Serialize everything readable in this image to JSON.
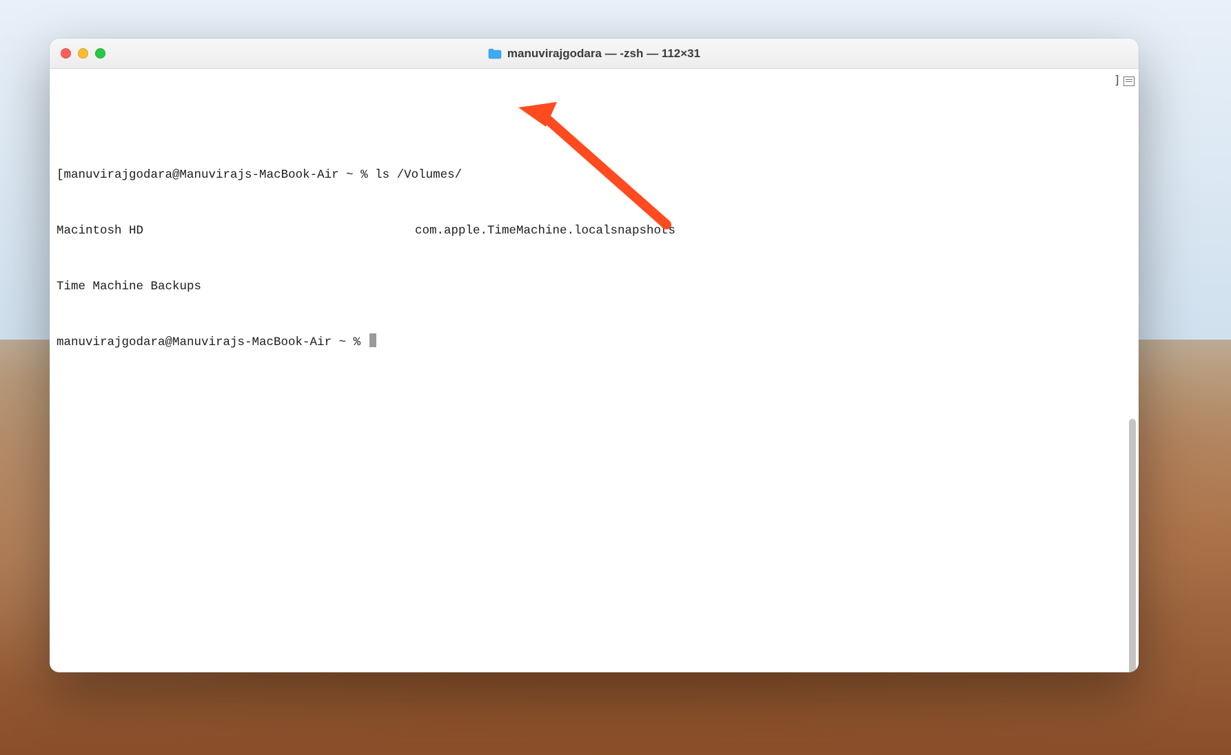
{
  "window": {
    "title": "manuvirajgodara — -zsh — 112×31",
    "traffic_lights": {
      "close": "#ff5f57",
      "minimize": "#febc2e",
      "maximize": "#28c840"
    },
    "folder_icon": "folder-icon"
  },
  "terminal": {
    "line1_bracket": "[",
    "prompt1": "manuvirajgodara@Manuvirajs-MacBook-Air ~ % ",
    "command1": "ls /Volumes/",
    "output_col1_row1": "Macintosh HD",
    "output_col2_row1": "com.apple.TimeMachine.localsnapshots",
    "output_col1_row2": "Time Machine Backups",
    "prompt2": "manuvirajgodara@Manuvirajs-MacBook-Air ~ % ",
    "cursor": "block"
  },
  "annotation": {
    "arrow_color": "#ff4b1f",
    "points_to": "command1"
  }
}
